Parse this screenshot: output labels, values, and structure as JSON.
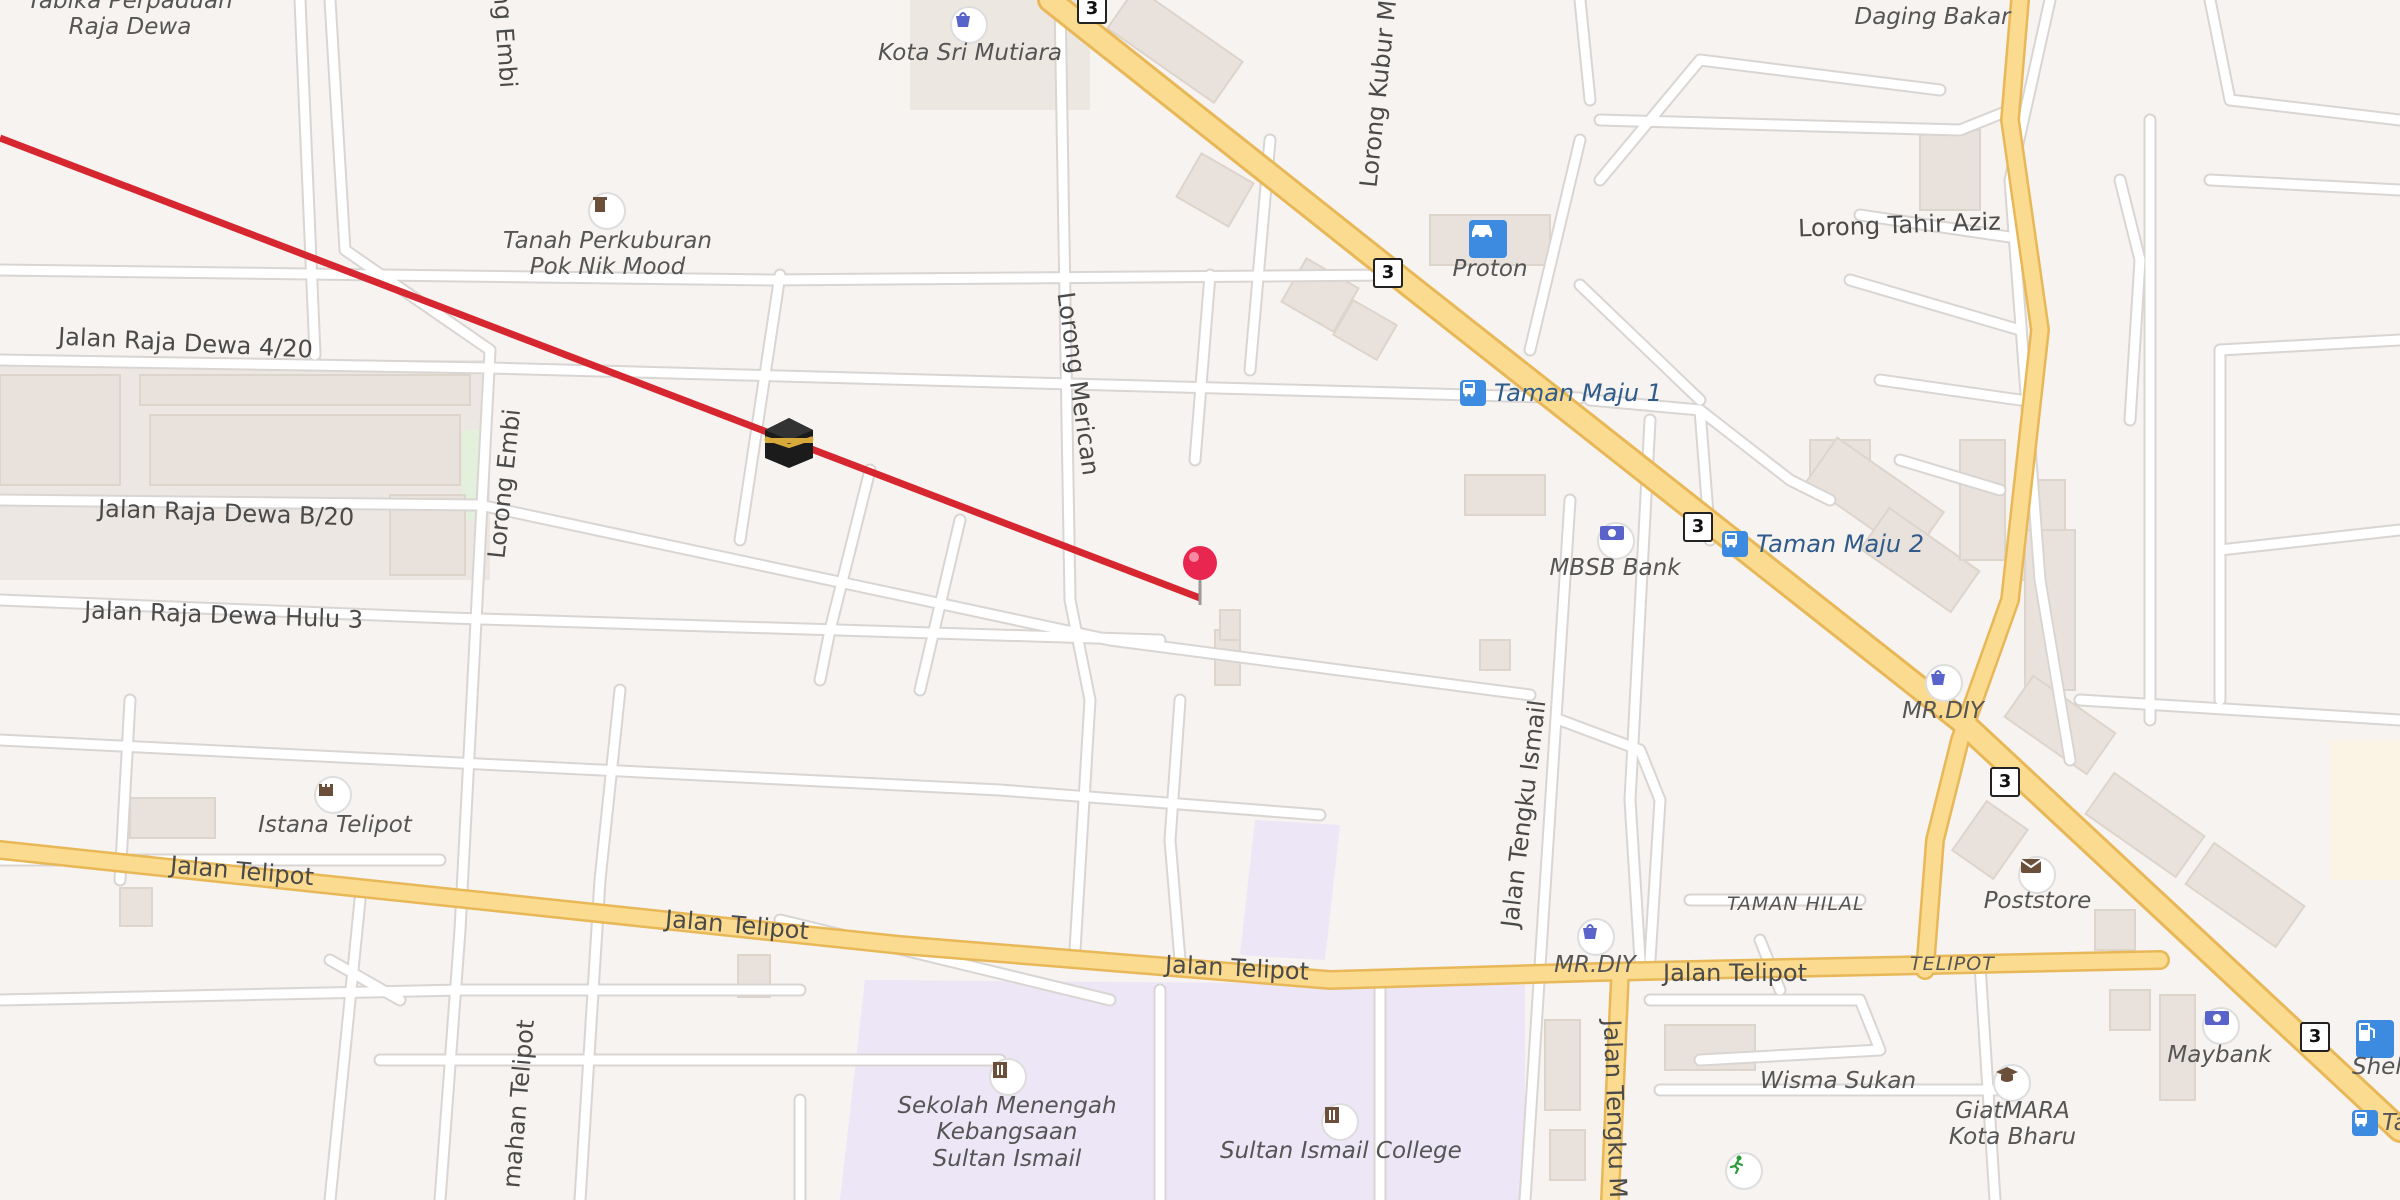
{
  "map": {
    "streets": {
      "jalan_raja_dewa_4_20": "Jalan Raja Dewa 4/20",
      "jalan_raja_dewa_b_20": "Jalan Raja Dewa B/20",
      "jalan_raja_dewa_hulu_3": "Jalan Raja Dewa Hulu 3",
      "lorong_embi": "Lorong Embi",
      "lorong_embi_top": "ng Embi",
      "lorong_merican": "Lorong Merican",
      "lorong_kubur": "Lorong Kubur M",
      "lorong_tahir_aziz": "Lorong Tahir Aziz",
      "jalan_telipot_1": "Jalan Telipot",
      "jalan_telipot_2": "Jalan Telipot",
      "jalan_telipot_3": "Jalan Telipot",
      "jalan_telipot_4": "Jalan Telipot",
      "jalan_tengku_ismail": "Jalan Tengku Ismail",
      "jalan_tengku_m": "Jalan Tengku M",
      "lorong_telipot": "mahan Telipot",
      "taman_hilal": "TAMAN HILAL",
      "telipot": "TELIPOT"
    },
    "route_shields": [
      "3",
      "3",
      "3",
      "3",
      "3"
    ],
    "pois": {
      "tabika": "Tabika Perpaduan\nRaja Dewa",
      "kota_sri_mutiara": "Kota Sri Mutiara",
      "daging_bakar": "Daging Bakar",
      "tanah_perkuburan": "Tanah Perkuburan\nPok Nik Mood",
      "proton": "Proton",
      "taman_maju_1": "Taman Maju 1",
      "taman_maju_2": "Taman Maju 2",
      "mbsb_bank": "MBSB Bank",
      "mr_diy_1": "MR.DIY",
      "mr_diy_2": "MR.DIY",
      "istana_telipot": "Istana Telipot",
      "poststore": "Poststore",
      "sekolah": "Sekolah Menengah\nKebangsaan\nSultan Ismail",
      "sultan_ismail_college": "Sultan Ismail College",
      "wisma_sukan": "Wisma Sukan",
      "giatmara": "GiatMARA\nKota Bharu",
      "maybank": "Maybank",
      "shell": "Shell",
      "ta": "Ta"
    },
    "icons": [
      "kaaba-icon",
      "location-pin-icon",
      "shopping-bag-icon",
      "cemetery-icon",
      "car-dealer-icon",
      "bus-stop-icon",
      "bank-icon",
      "castle-icon",
      "post-office-icon",
      "school-icon",
      "sports-icon",
      "education-icon",
      "fuel-icon"
    ],
    "colors": {
      "background": "#f6f3f0",
      "major_road": "#fbdb8f",
      "qibla_line": "#d6262f",
      "pin": "#e8264f",
      "school_area": "#ece6f6"
    }
  }
}
